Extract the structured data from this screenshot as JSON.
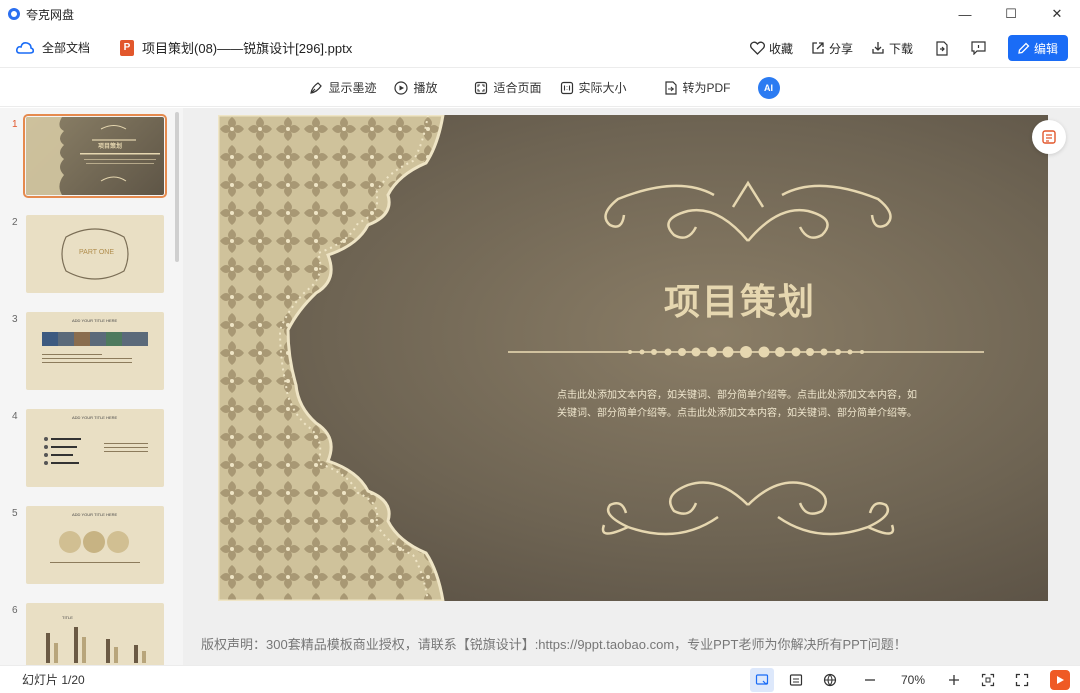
{
  "app": {
    "title": "夸克网盘"
  },
  "window": {
    "minimize": "—",
    "maximize": "☐",
    "close": "✕"
  },
  "header": {
    "all_docs": "全部文档",
    "file_badge": "P",
    "file_name": "项目策划(08)——锐旗设计[296].pptx",
    "favorite": "收藏",
    "share": "分享",
    "download": "下载",
    "edit": "编辑"
  },
  "toolbar": {
    "ink": "显示墨迹",
    "play": "播放",
    "fit_page": "适合页面",
    "actual_size": "实际大小",
    "to_pdf": "转为PDF",
    "ai": "AI"
  },
  "sidebar": {
    "thumbnails": [
      {
        "num": "1",
        "style": "dark",
        "title": "项目策划"
      },
      {
        "num": "2",
        "style": "light",
        "title": "PART ONE"
      },
      {
        "num": "3",
        "style": "light",
        "title": "ADD YOUR TITLE HERE"
      },
      {
        "num": "4",
        "style": "light",
        "title": "ADD YOUR TITLE HERE"
      },
      {
        "num": "5",
        "style": "light",
        "title": "ADD YOUR TITLE HERE"
      },
      {
        "num": "6",
        "style": "light",
        "title": "TITLE"
      }
    ]
  },
  "slide": {
    "title": "项目策划",
    "body_line1": "点击此处添加文本内容，如关键词、部分简单介绍等。点击此处添加文本内容，如",
    "body_line2": "关键词、部分简单介绍等。点击此处添加文本内容，如关键词、部分简单介绍等。"
  },
  "copyright": "版权声明：300套精品模板商业授权，请联系【锐旗设计】:https://9ppt.taobao.com，专业PPT老师为你解决所有PPT问题！",
  "status": {
    "slide_count": "幻灯片 1/20",
    "zoom": "70%"
  },
  "colors": {
    "accent": "#1a6cf6",
    "ppt_orange": "#e2572c",
    "slide_gold": "#e6d7b0"
  }
}
